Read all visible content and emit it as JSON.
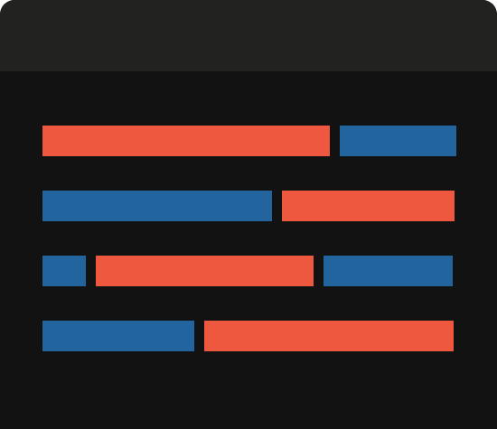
{
  "colors": {
    "window_bg": "#121212",
    "titlebar_bg": "#222320",
    "orange": "#EE583E",
    "blue": "#21649E"
  },
  "rows": [
    {
      "segments": [
        {
          "color": "orange",
          "fraction": 0.6974
        },
        {
          "color": "blue",
          "fraction": 0.2829
        }
      ]
    },
    {
      "segments": [
        {
          "color": "blue",
          "fraction": 0.557
        },
        {
          "color": "orange",
          "fraction": 0.4189
        }
      ]
    },
    {
      "segments": [
        {
          "color": "blue",
          "fraction": 0.1053
        },
        {
          "color": "orange",
          "fraction": 0.5285
        },
        {
          "color": "blue",
          "fraction": 0.3136
        }
      ]
    },
    {
      "segments": [
        {
          "color": "blue",
          "fraction": 0.3684
        },
        {
          "color": "orange",
          "fraction": 0.6053
        }
      ]
    }
  ]
}
